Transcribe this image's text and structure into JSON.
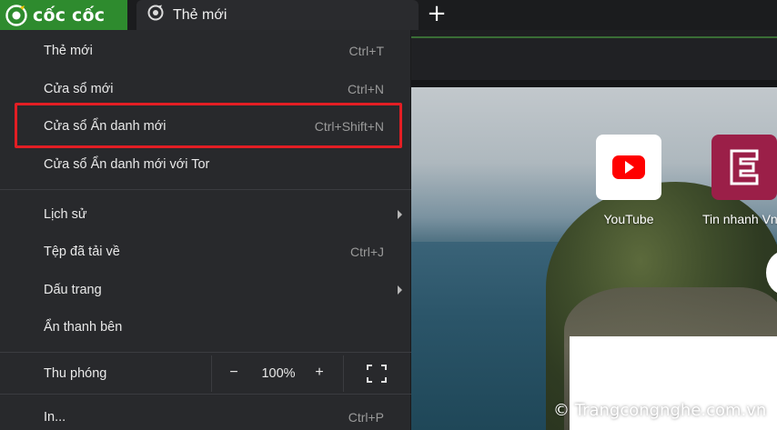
{
  "browser": {
    "brand_name": "cốc cốc",
    "brand_color": "#2e8b2e",
    "brand_icon": "coccoc-logo-icon"
  },
  "tabs": [
    {
      "label": "Thẻ mới",
      "icon": "coccoc-tab-icon"
    }
  ],
  "new_tab_button": "+",
  "menu": {
    "items": [
      {
        "label": "Thẻ mới",
        "shortcut": "Ctrl+T"
      },
      {
        "label": "Cửa sổ mới",
        "shortcut": "Ctrl+N"
      },
      {
        "label": "Cửa sổ Ẩn danh mới",
        "shortcut": "Ctrl+Shift+N",
        "highlighted": true
      },
      {
        "label": "Cửa sổ Ẩn danh mới với Tor",
        "shortcut": ""
      },
      {
        "label": "Lịch sử",
        "shortcut": "",
        "submenu": true
      },
      {
        "label": "Tệp đã tải về",
        "shortcut": "Ctrl+J"
      },
      {
        "label": "Dấu trang",
        "shortcut": "",
        "submenu": true
      },
      {
        "label": "Ẩn thanh bên",
        "shortcut": ""
      },
      {
        "label": "In...",
        "shortcut": "Ctrl+P"
      }
    ],
    "highlight_color": "#e31e24",
    "zoom": {
      "label": "Thu phóng",
      "minus": "−",
      "value": "100%",
      "plus": "+",
      "fullscreen_icon": "fullscreen-icon"
    }
  },
  "shortcuts": [
    {
      "label": "YouTube",
      "icon": "youtube-icon",
      "color": "#ff0000"
    },
    {
      "label": "Tin nhanh VnE",
      "icon": "vnexpress-icon",
      "color": "#9b1f48"
    }
  ],
  "watermark": "© Trangcongnghe.com.vn"
}
